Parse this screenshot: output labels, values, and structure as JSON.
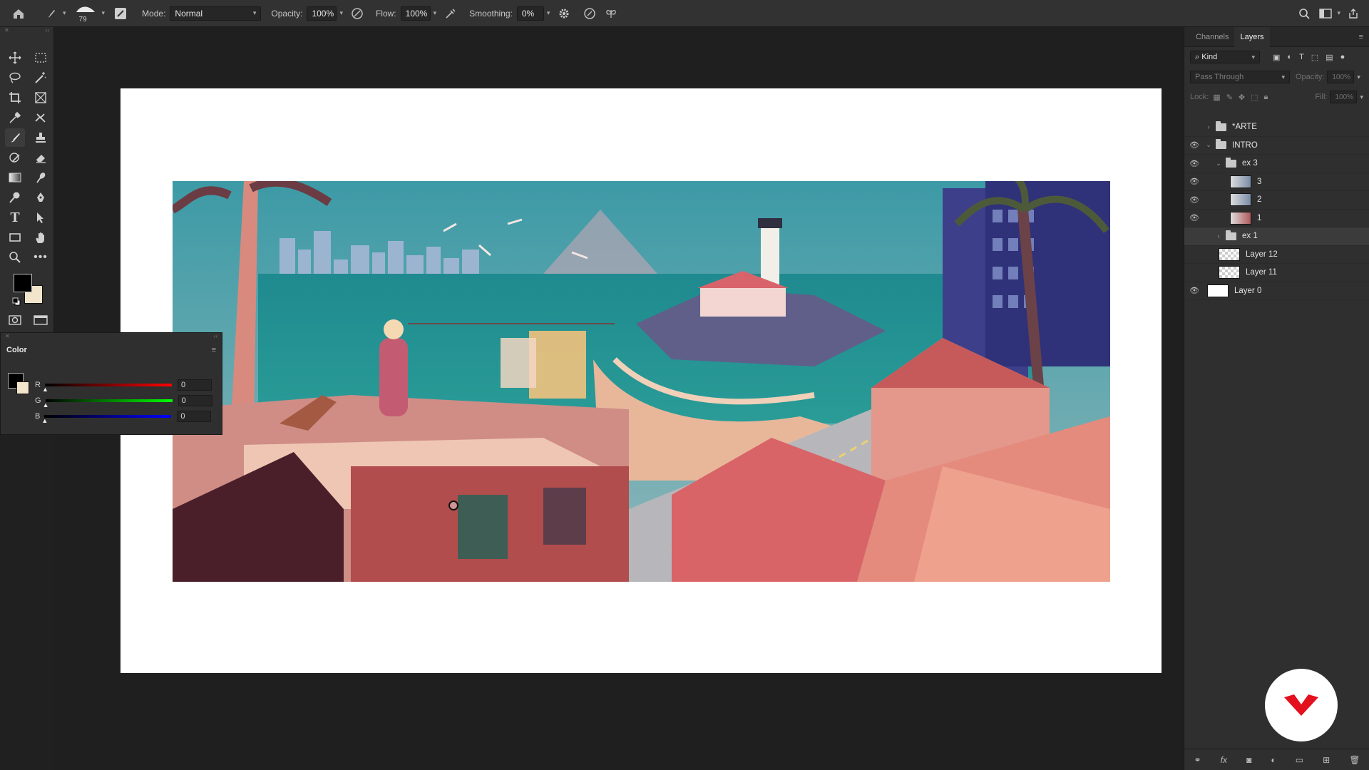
{
  "optionsbar": {
    "brush_size": "79",
    "mode_label": "Mode:",
    "mode_value": "Normal",
    "opacity_label": "Opacity:",
    "opacity_value": "100%",
    "flow_label": "Flow:",
    "flow_value": "100%",
    "smoothing_label": "Smoothing:",
    "smoothing_value": "0%"
  },
  "colorpanel": {
    "title": "Color",
    "r_label": "R",
    "g_label": "G",
    "b_label": "B",
    "r_value": "0",
    "g_value": "0",
    "b_value": "0",
    "foreground": "#000000",
    "background": "#f3e4cc"
  },
  "rightpanel": {
    "tabs": [
      {
        "label": "Channels"
      },
      {
        "label": "Layers"
      }
    ],
    "filter_kind": "Kind",
    "blend_mode": "Pass Through",
    "opacity_label": "Opacity:",
    "opacity_value": "100%",
    "lock_label": "Lock:",
    "fill_label": "Fill:",
    "fill_value": "100%",
    "layers": [
      {
        "name": "*ARTE"
      },
      {
        "name": "INTRO"
      },
      {
        "name": "ex 3"
      },
      {
        "name": "3"
      },
      {
        "name": "2"
      },
      {
        "name": "1"
      },
      {
        "name": "ex 1"
      },
      {
        "name": "Layer 12"
      },
      {
        "name": "Layer 11"
      },
      {
        "name": "Layer 0"
      }
    ]
  },
  "colors": {
    "accent_logo": "#e3101d",
    "app_bg": "#202020",
    "panel_bg": "#2f2f2f"
  }
}
